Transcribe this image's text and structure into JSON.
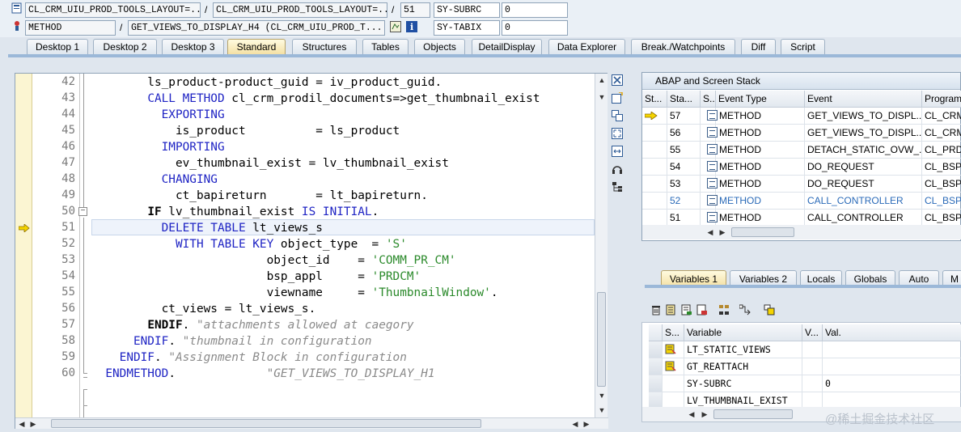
{
  "header": {
    "row1": {
      "program": "CL_CRM_UIU_PROD_TOOLS_LAYOUT=...",
      "include": "CL_CRM_UIU_PROD_TOOLS_LAYOUT=...",
      "line": "51",
      "var_name": "SY-SUBRC",
      "var_value": "0"
    },
    "row2": {
      "type": "METHOD",
      "event": "GET_VIEWS_TO_DISPLAY_H4 (CL_CRM_UIU_PROD_T...",
      "var_name": "SY-TABIX",
      "var_value": "0"
    },
    "slash": "/"
  },
  "tabs": [
    "Desktop 1",
    "Desktop 2",
    "Desktop 3",
    "Standard",
    "Structures",
    "Tables",
    "Objects",
    "DetailDisplay",
    "Data Explorer",
    "Break./Watchpoints",
    "Diff",
    "Script"
  ],
  "active_tab": "Standard",
  "code": {
    "line_numbers": [
      "42",
      "43",
      "44",
      "45",
      "46",
      "47",
      "48",
      "49",
      "50",
      "51",
      "52",
      "53",
      "54",
      "55",
      "56",
      "57",
      "58",
      "59",
      "60"
    ],
    "current_line": "51",
    "lines": [
      [
        {
          "t": "        ls_product-product_guid = iv_product_guid.",
          "c": ""
        }
      ],
      [
        {
          "t": "        ",
          "c": ""
        },
        {
          "t": "CALL METHOD",
          "c": "kw"
        },
        {
          "t": " cl_crm_prodil_documents=>get_thumbnail_exist",
          "c": ""
        }
      ],
      [
        {
          "t": "          ",
          "c": ""
        },
        {
          "t": "EXPORTING",
          "c": "kw"
        }
      ],
      [
        {
          "t": "            is_product          = ls_product",
          "c": ""
        }
      ],
      [
        {
          "t": "          ",
          "c": ""
        },
        {
          "t": "IMPORTING",
          "c": "kw"
        }
      ],
      [
        {
          "t": "            ev_thumbnail_exist = lv_thumbnail_exist",
          "c": ""
        }
      ],
      [
        {
          "t": "          ",
          "c": ""
        },
        {
          "t": "CHANGING",
          "c": "kw"
        }
      ],
      [
        {
          "t": "            ct_bapireturn       = lt_bapireturn.",
          "c": ""
        }
      ],
      [
        {
          "t": "        ",
          "c": ""
        },
        {
          "t": "IF",
          "c": "kwb"
        },
        {
          "t": " lv_thumbnail_exist ",
          "c": ""
        },
        {
          "t": "IS INITIAL",
          "c": "kw"
        },
        {
          "t": ".",
          "c": ""
        }
      ],
      [
        {
          "t": "          ",
          "c": ""
        },
        {
          "t": "DELETE TABLE",
          "c": "kw"
        },
        {
          "t": " lt_views_s",
          "c": ""
        }
      ],
      [
        {
          "t": "            ",
          "c": ""
        },
        {
          "t": "WITH TABLE KEY",
          "c": "kw"
        },
        {
          "t": " object_type  = ",
          "c": ""
        },
        {
          "t": "'S'",
          "c": "str"
        }
      ],
      [
        {
          "t": "                         object_id    = ",
          "c": ""
        },
        {
          "t": "'COMM_PR_CM'",
          "c": "str"
        }
      ],
      [
        {
          "t": "                         bsp_appl     = ",
          "c": ""
        },
        {
          "t": "'PRDCM'",
          "c": "str"
        }
      ],
      [
        {
          "t": "                         viewname     = ",
          "c": ""
        },
        {
          "t": "'ThumbnailWindow'",
          "c": "str"
        },
        {
          "t": ".",
          "c": ""
        }
      ],
      [
        {
          "t": "          ct_views = lt_views_s.",
          "c": ""
        }
      ],
      [
        {
          "t": "        ",
          "c": ""
        },
        {
          "t": "ENDIF",
          "c": "kwb"
        },
        {
          "t": ". ",
          "c": ""
        },
        {
          "t": "\"attachments allowed at caegory",
          "c": "cmt"
        }
      ],
      [
        {
          "t": "      ",
          "c": ""
        },
        {
          "t": "ENDIF",
          "c": "kw"
        },
        {
          "t": ". ",
          "c": ""
        },
        {
          "t": "\"thumbnail in configuration",
          "c": "cmt"
        }
      ],
      [
        {
          "t": "    ",
          "c": ""
        },
        {
          "t": "ENDIF",
          "c": "kw"
        },
        {
          "t": ". ",
          "c": ""
        },
        {
          "t": "\"Assignment Block in configuration",
          "c": "cmt"
        }
      ],
      [
        {
          "t": "  ",
          "c": ""
        },
        {
          "t": "ENDMETHOD",
          "c": "kw"
        },
        {
          "t": ".             ",
          "c": ""
        },
        {
          "t": "\"GET_VIEWS_TO_DISPLAY_H1",
          "c": "cmt"
        }
      ]
    ]
  },
  "stack": {
    "title": "ABAP and Screen Stack",
    "columns": [
      "St...",
      "Sta...",
      "S...",
      "Event Type",
      "Event",
      "Program"
    ],
    "rows": [
      {
        "current": true,
        "level": "57",
        "type": "METHOD",
        "event": "GET_VIEWS_TO_DISPL...",
        "program": "CL_CRM_",
        "hl": false
      },
      {
        "current": false,
        "level": "56",
        "type": "METHOD",
        "event": "GET_VIEWS_TO_DISPL...",
        "program": "CL_CRM_",
        "hl": false
      },
      {
        "current": false,
        "level": "55",
        "type": "METHOD",
        "event": "DETACH_STATIC_OVW_...",
        "program": "CL_PRDC",
        "hl": false
      },
      {
        "current": false,
        "level": "54",
        "type": "METHOD",
        "event": "DO_REQUEST",
        "program": "CL_BSP_",
        "hl": false
      },
      {
        "current": false,
        "level": "53",
        "type": "METHOD",
        "event": "DO_REQUEST",
        "program": "CL_BSP_",
        "hl": false
      },
      {
        "current": false,
        "level": "52",
        "type": "METHOD",
        "event": "CALL_CONTROLLER",
        "program": "CL_BSP_",
        "hl": true
      },
      {
        "current": false,
        "level": "51",
        "type": "METHOD",
        "event": "CALL_CONTROLLER",
        "program": "CL_BSP_",
        "hl": false
      }
    ]
  },
  "var_tabs": [
    "Variables 1",
    "Variables 2",
    "Locals",
    "Globals",
    "Auto",
    "M"
  ],
  "active_var_tab": "Variables 1",
  "vars": {
    "columns": [
      "S...",
      "Variable",
      "V...",
      "Val."
    ],
    "rows": [
      {
        "name": "LT_STATIC_VIEWS",
        "value": "",
        "icon": true
      },
      {
        "name": "GT_REATTACH",
        "value": "",
        "icon": true
      },
      {
        "name": "SY-SUBRC",
        "value": "0",
        "icon": false
      },
      {
        "name": "LV_THUMBNAIL_EXIST",
        "value": "",
        "icon": false
      }
    ]
  },
  "watermark": "@稀土掘金技术社区"
}
